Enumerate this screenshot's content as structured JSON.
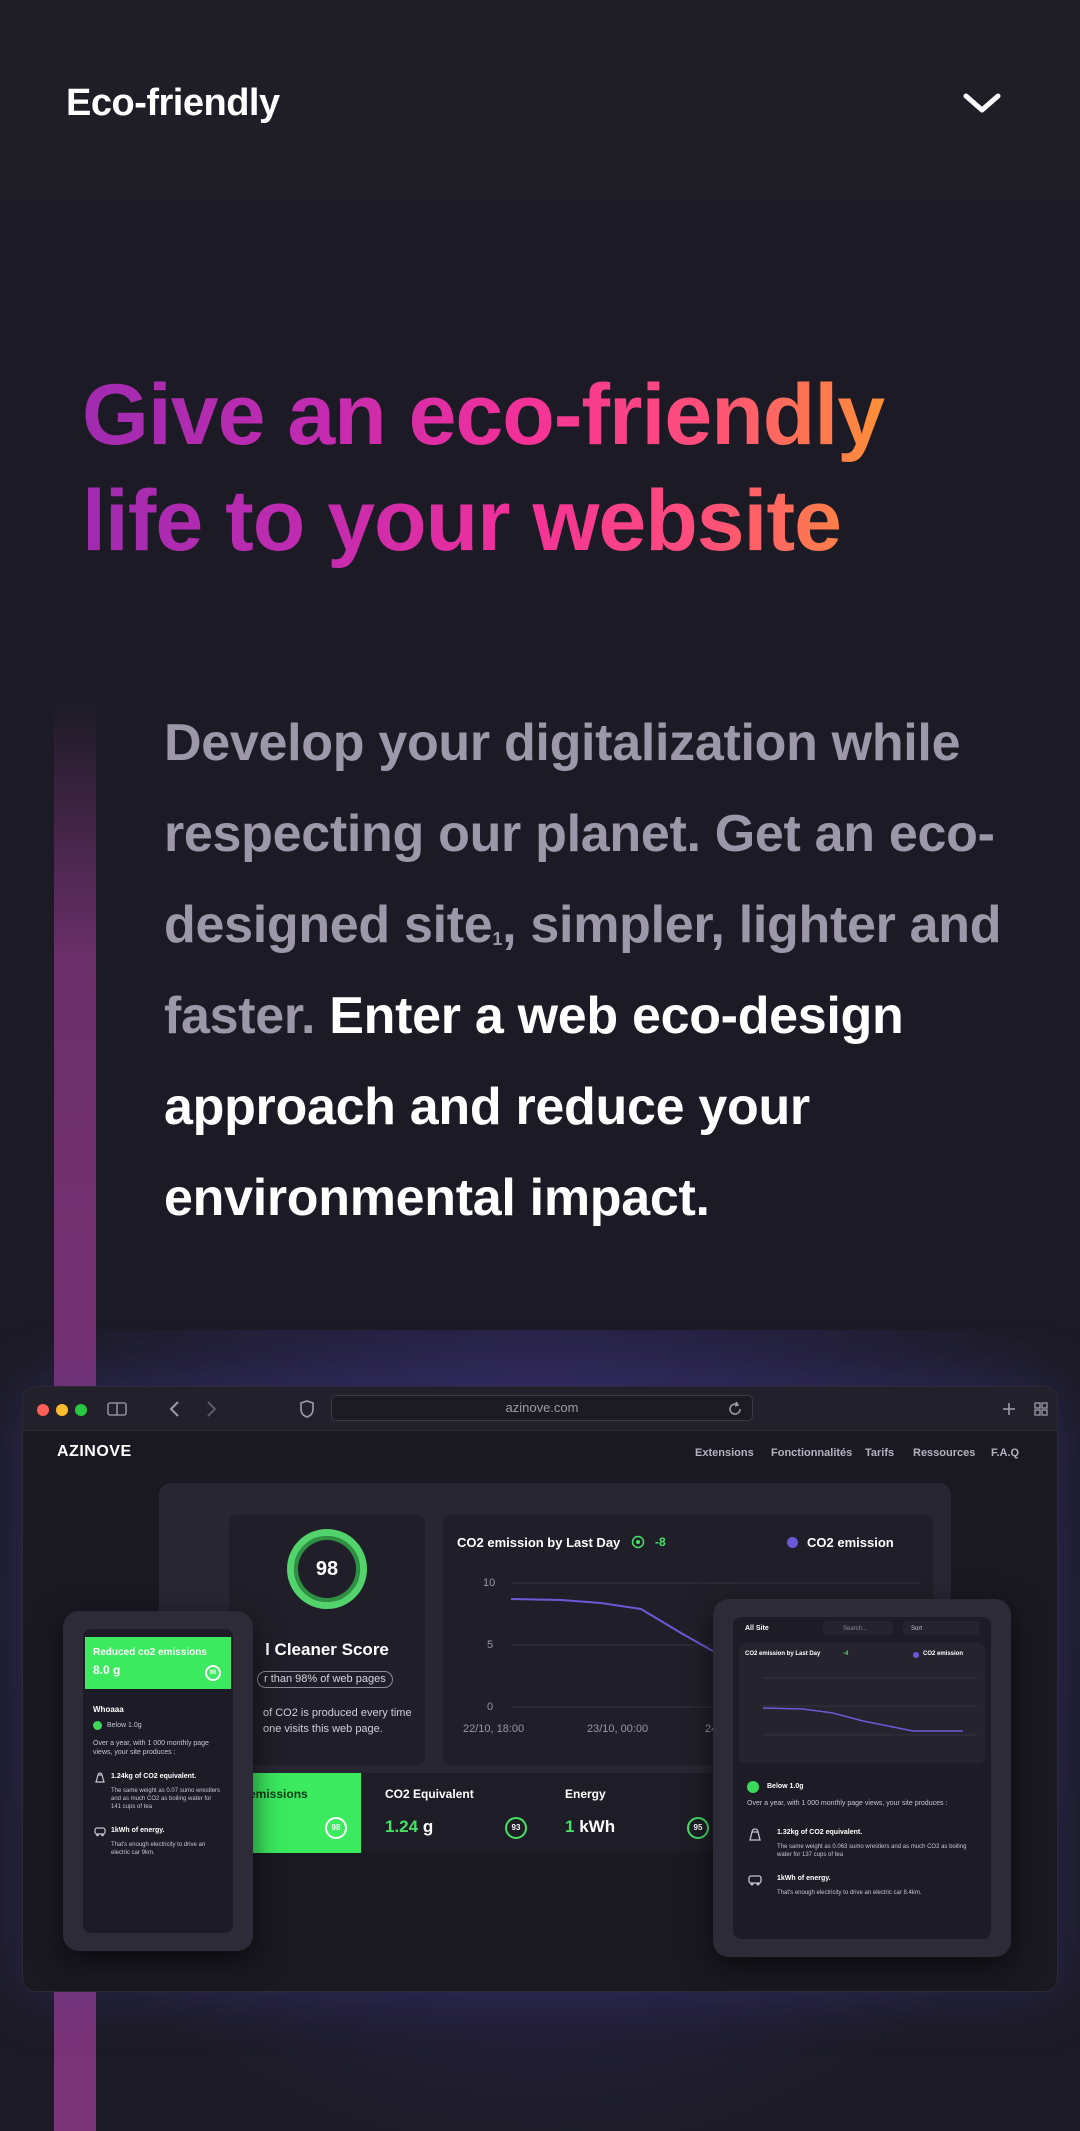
{
  "header": {
    "brand": "Eco-friendly",
    "menu_icon": "chevron-down-icon"
  },
  "hero": {
    "line1": "Give an eco-friendly",
    "line2": "life to your website"
  },
  "intro": {
    "muted_part1": "Develop your digitalization while respecting our planet. Get an eco-designed site",
    "footnote": "1",
    "muted_part2": ", simpler, lighter and faster.",
    "strong": " Enter a web eco-design approach and reduce your environmental impact."
  },
  "mockup": {
    "url": "azinove.com",
    "logo": "AZINOVE",
    "nav": [
      "Extensions",
      "Fonctionnalités",
      "Tarifs",
      "Ressources",
      "F.A.Q"
    ],
    "score": {
      "value": "98",
      "title": "l Cleaner Score",
      "badge": "r than 98% of web pages",
      "desc1": "of CO2 is produced every time",
      "desc2": "one visits this web page."
    },
    "chart": {
      "title": "CO2 emission by Last Day",
      "delta": "-8",
      "legend": "CO2 emission",
      "yticks": [
        "10",
        "5",
        "0"
      ],
      "xticks": [
        "22/10, 18:00",
        "23/10, 00:00",
        "24"
      ]
    },
    "metrics": [
      {
        "label": "emissions",
        "badge": "98"
      },
      {
        "label": "CO2 Equivalent",
        "value": "1.24",
        "unit": "g",
        "badge": "93"
      },
      {
        "label": "Energy",
        "value": "1",
        "unit": "kWh",
        "badge": "95"
      }
    ],
    "phone": {
      "banner_title": "Reduced co2 emissions",
      "banner_value": "8.0 g",
      "banner_badge": "98",
      "heading": "Whoaaa",
      "check": "Below 1.0g",
      "para": "Over a year, with 1 000 monthly page views, your site produces :",
      "item1_title": "1.24kg of CO2 equivalent.",
      "item1_desc": "The same weight as 0.07 sumo wrestlers and as much CO2 as boiling water for 141 cups of tea",
      "item2_title": "1kWh of energy.",
      "item2_desc": "That's enough electricity to drive an electric car 9km."
    },
    "tablet": {
      "tab": "All Site",
      "search": "Search...",
      "sort": "Sort",
      "chart_title": "CO2 emission by Last Day",
      "delta": "-4",
      "legend": "CO2 emission",
      "check": "Below 1.0g",
      "para": "Over a year, with 1 000 monthly page views, your site produces :",
      "item1_title": "1.32kg of CO2 equivalent.",
      "item1_desc": "The same weight as 0.063 sumo wrestlers and as much CO2 as boiling water for 137 cups of tea",
      "item2_title": "1kWh of energy.",
      "item2_desc": "That's enough electricity to drive an electric car 8.4km."
    }
  },
  "colors": {
    "background": "#1c1b25",
    "accent_green": "#3bea5f",
    "purple_line": "#6a5ad8",
    "gradient_start": "#a02bb0",
    "gradient_end": "#ffb21f"
  }
}
